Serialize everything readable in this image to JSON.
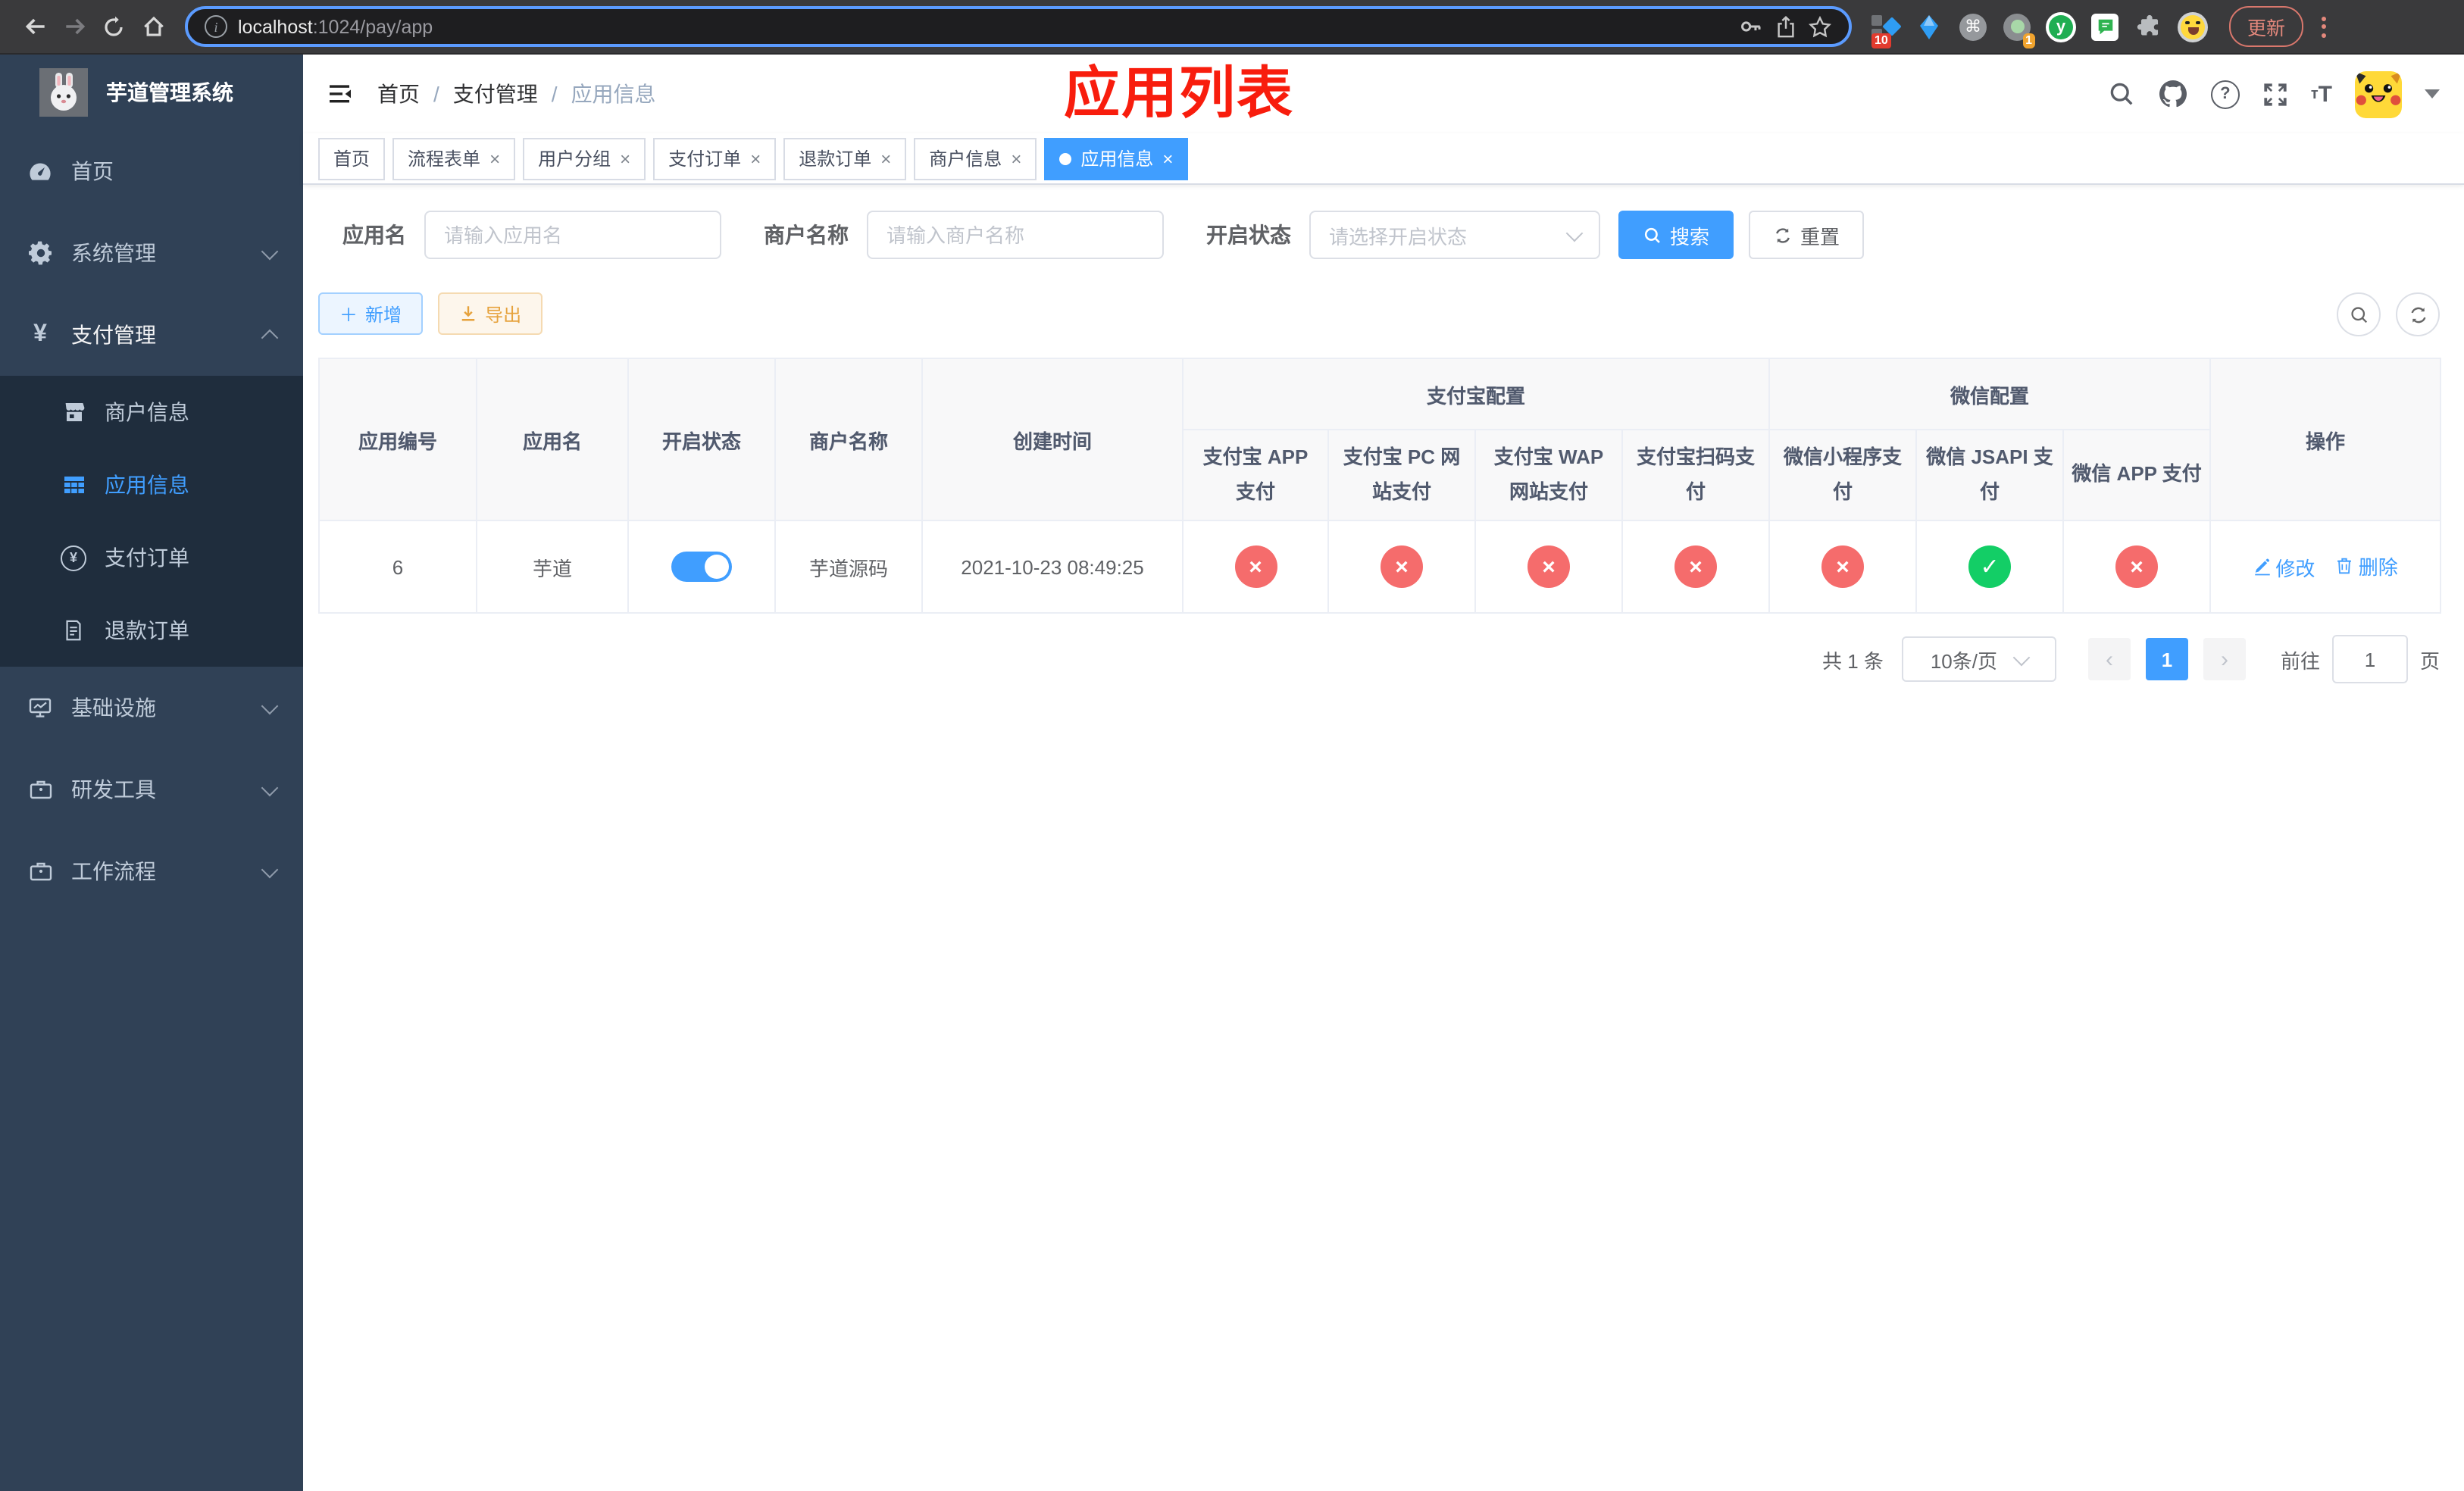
{
  "browser": {
    "url_host": "localhost",
    "url_path": ":1024/pay/app",
    "update_label": "更新",
    "ext_badge_10": "10",
    "ext_badge_1": "1",
    "ext_y_letter": "y",
    "cmd_glyph": "⌘"
  },
  "sidebar": {
    "title": "芋道管理系统",
    "items": [
      {
        "label": "首页"
      },
      {
        "label": "系统管理"
      },
      {
        "label": "支付管理"
      },
      {
        "label": "商户信息"
      },
      {
        "label": "应用信息"
      },
      {
        "label": "支付订单"
      },
      {
        "label": "退款订单"
      },
      {
        "label": "基础设施"
      },
      {
        "label": "研发工具"
      },
      {
        "label": "工作流程"
      }
    ]
  },
  "header": {
    "breadcrumb": [
      "首页",
      "支付管理",
      "应用信息"
    ],
    "separator": "/",
    "annotation": "应用列表",
    "font_icon_label": "тT"
  },
  "tabs": {
    "close_glyph": "×",
    "items": [
      {
        "label": "首页"
      },
      {
        "label": "流程表单"
      },
      {
        "label": "用户分组"
      },
      {
        "label": "支付订单"
      },
      {
        "label": "退款订单"
      },
      {
        "label": "商户信息"
      },
      {
        "label": "应用信息"
      }
    ]
  },
  "filters": {
    "app_name_label": "应用名",
    "app_name_placeholder": "请输入应用名",
    "merchant_label": "商户名称",
    "merchant_placeholder": "请输入商户名称",
    "status_label": "开启状态",
    "status_placeholder": "请选择开启状态",
    "search_button": "搜索",
    "reset_button": "重置"
  },
  "toolbar": {
    "add_button": "新增",
    "add_plus": "＋",
    "export_button": "导出"
  },
  "table": {
    "columns": [
      "应用编号",
      "应用名",
      "开启状态",
      "商户名称",
      "创建时间"
    ],
    "group_alipay": "支付宝配置",
    "group_wechat": "微信配置",
    "channel_columns": [
      "支付宝 APP 支付",
      "支付宝 PC 网站支付",
      "支付宝 WAP 网站支付",
      "支付宝扫码支付",
      "微信小程序支付",
      "微信 JSAPI 支付",
      "微信 APP 支付"
    ],
    "actions_column": "操作",
    "glyph_on": "✓",
    "glyph_off": "×",
    "row": {
      "app_id": "6",
      "app_name": "芋道",
      "status_on": true,
      "merchant": "芋道源码",
      "created": "2021-10-23 08:49:25",
      "channels": [
        {
          "name": "alipay_app",
          "enabled": false
        },
        {
          "name": "alipay_pc",
          "enabled": false
        },
        {
          "name": "alipay_wap",
          "enabled": false
        },
        {
          "name": "alipay_qr",
          "enabled": false
        },
        {
          "name": "wx_lite",
          "enabled": false
        },
        {
          "name": "wx_jsapi",
          "enabled": true
        },
        {
          "name": "wx_app",
          "enabled": false
        }
      ],
      "edit_label": "修改",
      "delete_label": "删除"
    }
  },
  "pagination": {
    "total_text": "共 1 条",
    "page_size": "10条/页",
    "current_page": "1",
    "goto_label": "前往",
    "goto_value": "1",
    "goto_suffix": "页"
  },
  "colors": {
    "accent": "#409eff",
    "danger": "#f56c6c",
    "success": "#13ce66",
    "warning": "#e6a23c",
    "sidebar_bg": "#304156",
    "submenu_bg": "#1f2d3d",
    "annotation_red": "#f81d0d"
  }
}
